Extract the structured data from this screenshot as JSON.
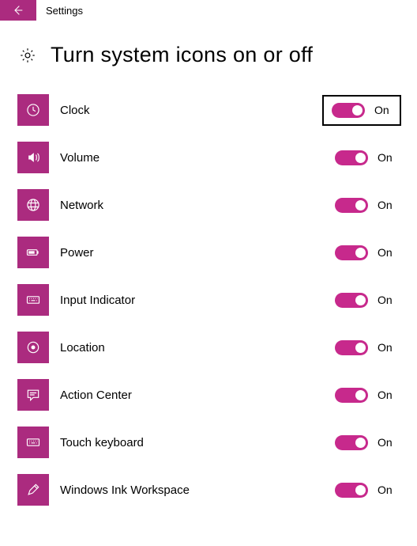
{
  "header": {
    "window_title": "Settings"
  },
  "page": {
    "title": "Turn system icons on or off"
  },
  "on_label": "On",
  "items": [
    {
      "id": "clock",
      "label": "Clock",
      "state": true,
      "highlighted": true
    },
    {
      "id": "volume",
      "label": "Volume",
      "state": true,
      "highlighted": false
    },
    {
      "id": "network",
      "label": "Network",
      "state": true,
      "highlighted": false
    },
    {
      "id": "power",
      "label": "Power",
      "state": true,
      "highlighted": false
    },
    {
      "id": "input-indicator",
      "label": "Input Indicator",
      "state": true,
      "highlighted": false
    },
    {
      "id": "location",
      "label": "Location",
      "state": true,
      "highlighted": false
    },
    {
      "id": "action-center",
      "label": "Action Center",
      "state": true,
      "highlighted": false
    },
    {
      "id": "touch-keyboard",
      "label": "Touch keyboard",
      "state": true,
      "highlighted": false
    },
    {
      "id": "ink-workspace",
      "label": "Windows Ink Workspace",
      "state": true,
      "highlighted": false
    }
  ],
  "accent_color": "#ab2b7f"
}
